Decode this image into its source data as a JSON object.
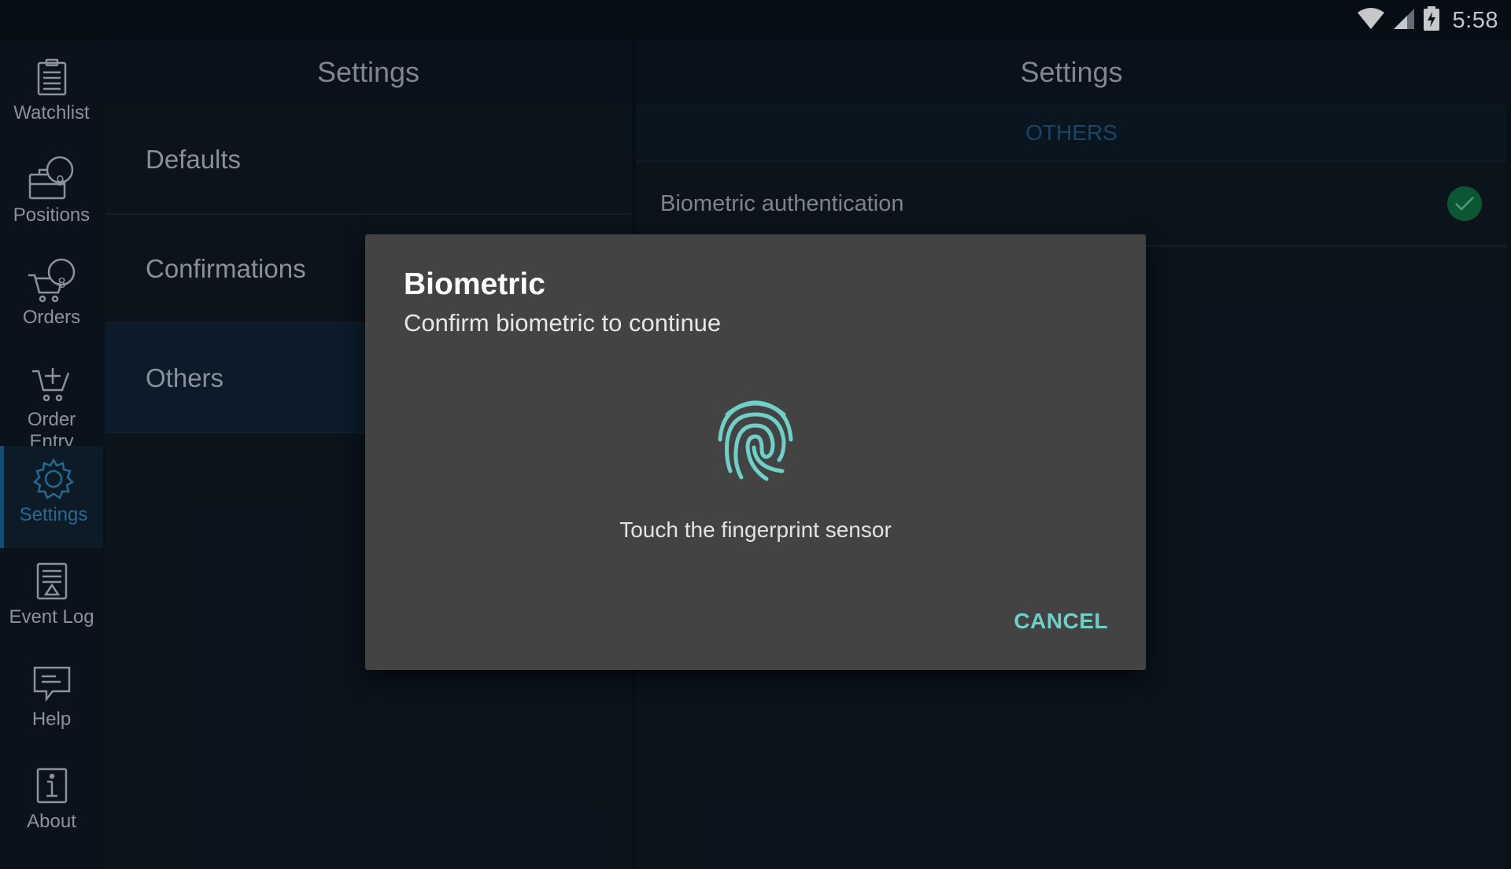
{
  "status_bar": {
    "time": "5:58",
    "icons": [
      "wifi-icon",
      "cell-signal-icon",
      "battery-charging-icon"
    ]
  },
  "nav": {
    "items": [
      {
        "label": "Watchlist",
        "icon": "clipboard-icon"
      },
      {
        "label": "Positions",
        "icon": "briefcase-icon",
        "badge": "9"
      },
      {
        "label": "Orders",
        "icon": "cart-icon",
        "badge": "8"
      },
      {
        "label": "Order\nEntry",
        "icon": "cart-add-icon"
      },
      {
        "label": "Settings",
        "icon": "gear-icon",
        "active": true
      },
      {
        "label": "Event Log",
        "icon": "event-log-icon"
      },
      {
        "label": "Help",
        "icon": "chat-bubble-icon"
      },
      {
        "label": "About",
        "icon": "info-icon"
      }
    ]
  },
  "left_pane": {
    "title": "Settings",
    "items": [
      "Defaults",
      "Confirmations",
      "Others"
    ],
    "active_item": "Others"
  },
  "right_pane": {
    "title": "Settings",
    "section": "OTHERS",
    "rows": [
      {
        "label": "Biometric authentication",
        "checked": true
      }
    ]
  },
  "dialog": {
    "title": "Biometric",
    "subtitle": "Confirm biometric to continue",
    "hint": "Touch the fingerprint sensor",
    "cancel_label": "CANCEL",
    "icon": "fingerprint-icon"
  },
  "colors": {
    "accent": "#6fd0c7",
    "active_nav": "#2f7fb3",
    "check": "#0f6b3f",
    "dialog_bg": "#434343"
  }
}
